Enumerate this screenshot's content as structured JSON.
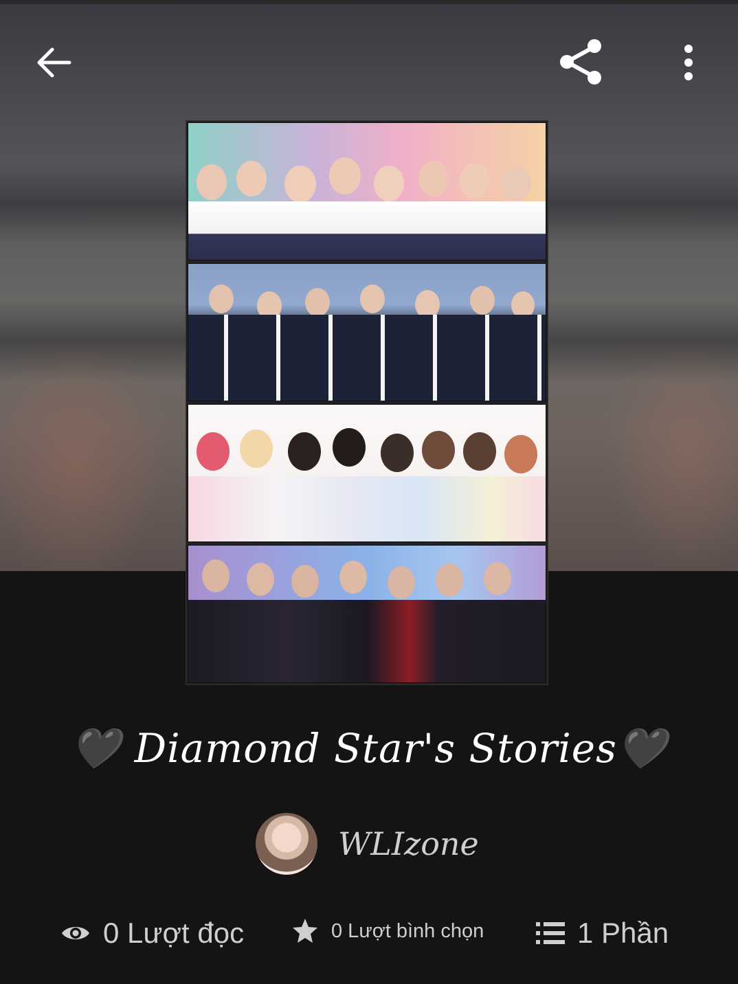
{
  "header": {
    "back_icon": "arrow-left-icon",
    "share_icon": "share-icon",
    "more_icon": "more-vertical-icon"
  },
  "story": {
    "title": "🖤 Diamond Star's Stories🖤",
    "author": "WLIzone"
  },
  "stats": {
    "reads": "0 Lượt đọc",
    "votes": "0 Lượt bình chọn",
    "parts": "1 Phần"
  },
  "colors": {
    "background": "#141414",
    "text": "#cfcfcf",
    "title": "#ffffff"
  }
}
